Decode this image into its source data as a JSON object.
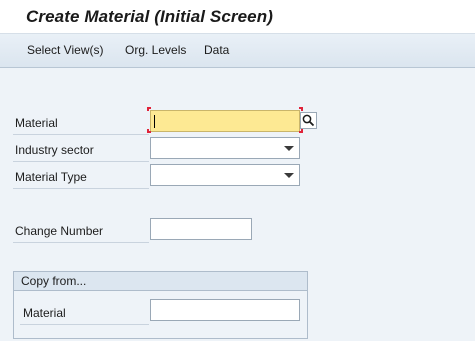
{
  "header": {
    "title": "Create Material (Initial Screen)"
  },
  "toolbar": {
    "select_views": "Select View(s)",
    "org_levels": "Org. Levels",
    "data": "Data"
  },
  "form": {
    "material_label": "Material",
    "material_value": "",
    "industry_sector_label": "Industry sector",
    "industry_sector_value": "",
    "material_type_label": "Material Type",
    "material_type_value": "",
    "change_number_label": "Change Number",
    "change_number_value": ""
  },
  "copy_from": {
    "title": "Copy from...",
    "material_label": "Material",
    "material_value": ""
  },
  "icons": {
    "search": "search-icon",
    "dropdown": "chevron-down-icon"
  },
  "colors": {
    "required_field": "#fde993",
    "required_marker": "#e0233a"
  }
}
